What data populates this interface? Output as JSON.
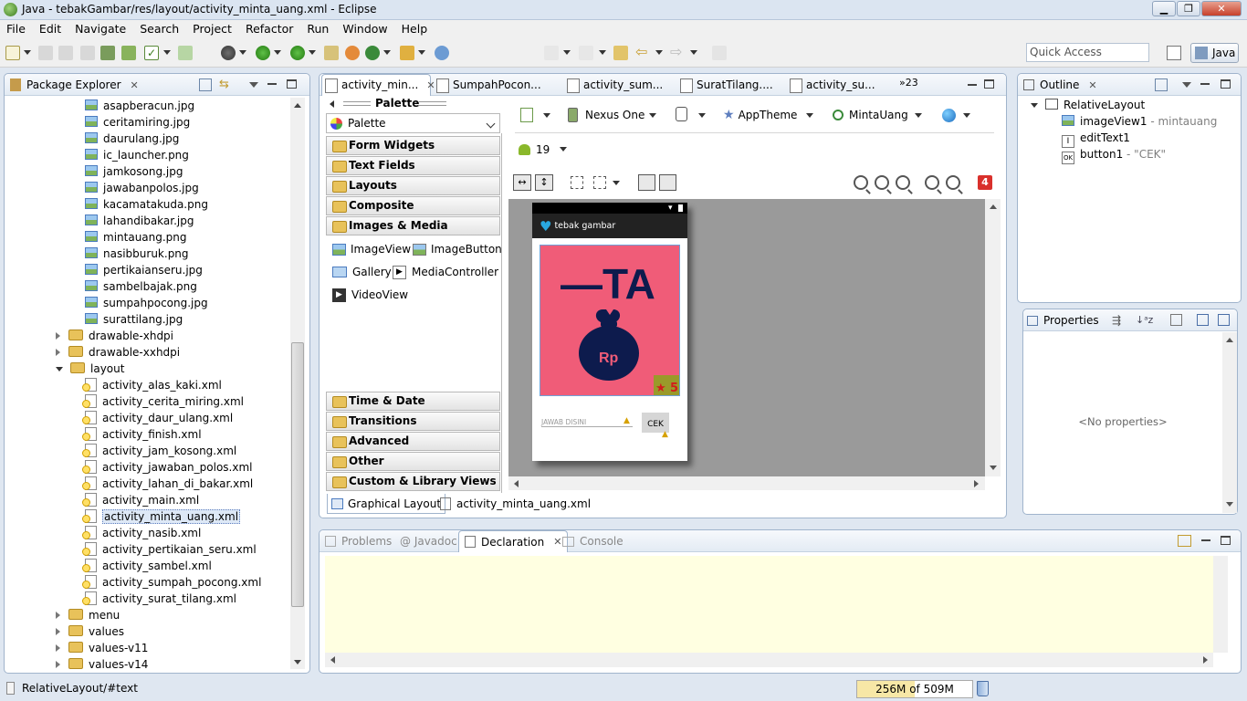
{
  "window": {
    "title": "Java - tebakGambar/res/layout/activity_minta_uang.xml - Eclipse"
  },
  "menu": [
    "File",
    "Edit",
    "Navigate",
    "Search",
    "Project",
    "Refactor",
    "Run",
    "Window",
    "Help"
  ],
  "quick_access": {
    "placeholder": "Quick Access"
  },
  "perspective": {
    "label": "Java"
  },
  "package_explorer": {
    "title": "Package Explorer",
    "images": [
      "asapberacun.jpg",
      "ceritamiring.jpg",
      "daurulang.jpg",
      "ic_launcher.png",
      "jamkosong.jpg",
      "jawabanpolos.jpg",
      "kacamatakuda.png",
      "lahandibakar.jpg",
      "mintauang.png",
      "nasibburuk.png",
      "pertikaianseru.jpg",
      "sambelbajak.png",
      "sumpahpocong.jpg",
      "surattilang.jpg"
    ],
    "folders_before": [
      "drawable-xhdpi",
      "drawable-xxhdpi"
    ],
    "layout_folder": "layout",
    "layouts": [
      "activity_alas_kaki.xml",
      "activity_cerita_miring.xml",
      "activity_daur_ulang.xml",
      "activity_finish.xml",
      "activity_jam_kosong.xml",
      "activity_jawaban_polos.xml",
      "activity_lahan_di_bakar.xml",
      "activity_main.xml",
      "activity_minta_uang.xml",
      "activity_nasib.xml",
      "activity_pertikaian_seru.xml",
      "activity_sambel.xml",
      "activity_sumpah_pocong.xml",
      "activity_surat_tilang.xml"
    ],
    "selected_layout": "activity_minta_uang.xml",
    "folders_after": [
      "menu",
      "values",
      "values-v11",
      "values-v14"
    ]
  },
  "editor_tabs": [
    "activity_min...",
    "SumpahPocon...",
    "activity_sum...",
    "SuratTilang....",
    "activity_su..."
  ],
  "editor_tabs_more": "»23",
  "palette": {
    "header": "Palette",
    "dropdown": "Palette",
    "categories_top": [
      "Form Widgets",
      "Text Fields",
      "Layouts",
      "Composite",
      "Images & Media"
    ],
    "widgets": [
      "ImageView",
      "ImageButton",
      "Gallery",
      "MediaController",
      "VideoView"
    ],
    "categories_bottom": [
      "Time & Date",
      "Transitions",
      "Advanced",
      "Other",
      "Custom & Library Views"
    ]
  },
  "layout_toolbar": {
    "device": "Nexus One",
    "theme": "AppTheme",
    "activity": "MintaUang",
    "api": "19",
    "error_count": "4"
  },
  "device_preview": {
    "app_title": "tebak gambar",
    "image_text": "—TA",
    "bag_text": "Rp",
    "star_badge": "5",
    "edit_hint": "JAWAB DISINI",
    "button_label": "CEK",
    "image_bg": "#f05c78",
    "bag_color": "#0d1b4d"
  },
  "editor_bottom_tabs": [
    "Graphical Layout",
    "activity_minta_uang.xml"
  ],
  "outline": {
    "title": "Outline",
    "root": "RelativeLayout",
    "items": [
      {
        "name": "imageView1",
        "detail": " - mintauang"
      },
      {
        "name": "editText1",
        "detail": ""
      },
      {
        "name": "button1",
        "detail": " - \"CEK\""
      }
    ]
  },
  "properties": {
    "title": "Properties",
    "empty": "<No properties>"
  },
  "bottom_tabs": [
    "Problems",
    "@ Javadoc",
    "Declaration",
    "Console"
  ],
  "status": {
    "path": "RelativeLayout/#text",
    "memory": "256M of 509M"
  }
}
